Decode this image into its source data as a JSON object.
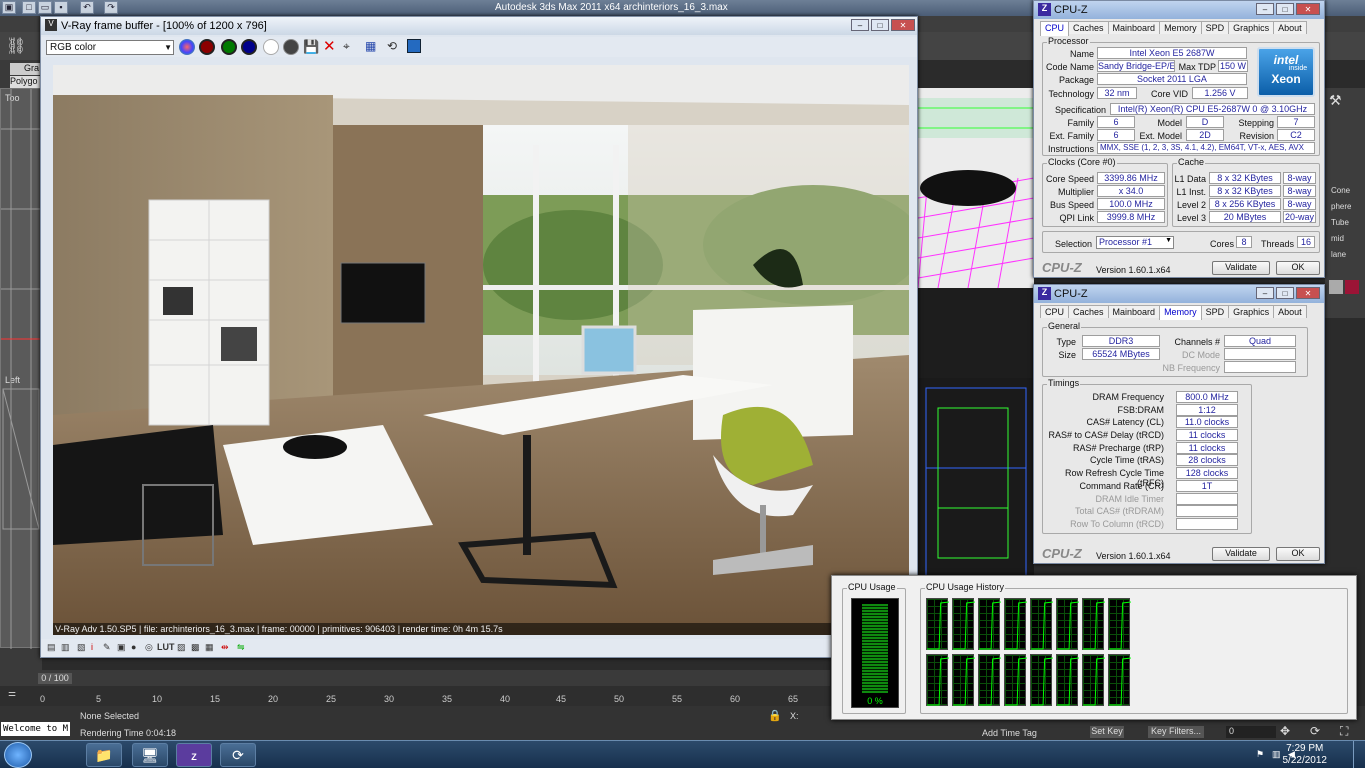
{
  "max": {
    "title": "Autodesk 3ds Max  2011 x64     archinteriors_16_3.max",
    "left_labels": [
      "Gra",
      "Polygo",
      "Too",
      "Left"
    ],
    "status": {
      "selection": "None Selected",
      "render_time": "Rendering Time  0:04:18",
      "frame_counter": "0 / 100",
      "coord": "X:"
    },
    "timeline_ticks": [
      "0",
      "5",
      "10",
      "15",
      "20",
      "25",
      "30",
      "35",
      "40",
      "45",
      "50",
      "55",
      "60",
      "65"
    ],
    "right_labels": [
      "Add Time Tag",
      "Set Key",
      "Key Filters...",
      "0"
    ],
    "cmd_labels": [
      "Cone",
      "phere",
      "Tube",
      "mid",
      "lane"
    ],
    "maxscript": "Welcome to M"
  },
  "vray": {
    "title": "V-Ray frame buffer - [100% of 1200 x 796]",
    "channel": "RGB color",
    "status_line": "V-Ray Adv 1.50.SP5 | file: archinteriors_16_3.max | frame: 00000 | primitives: 906403 | render time: 0h 4m 15.7s",
    "bottom_label": "LUT"
  },
  "cpuz1": {
    "title": "CPU-Z",
    "tabs": [
      "CPU",
      "Caches",
      "Mainboard",
      "Memory",
      "SPD",
      "Graphics",
      "About"
    ],
    "active_tab": "CPU",
    "processor_group": "Processor",
    "name_l": "Name",
    "name": "Intel Xeon E5 2687W",
    "codename_l": "Code Name",
    "codename": "Sandy Bridge-EP/EX",
    "maxtdp_l": "Max TDP",
    "maxtdp": "150 W",
    "package_l": "Package",
    "package": "Socket 2011 LGA",
    "technology_l": "Technology",
    "technology": "32 nm",
    "corevid_l": "Core VID",
    "corevid": "1.256 V",
    "spec_l": "Specification",
    "spec": "Intel(R) Xeon(R) CPU E5-2687W 0 @ 3.10GHz",
    "family_l": "Family",
    "family": "6",
    "model_l": "Model",
    "model": "D",
    "stepping_l": "Stepping",
    "stepping": "7",
    "extfamily_l": "Ext. Family",
    "extfamily": "6",
    "extmodel_l": "Ext. Model",
    "extmodel": "2D",
    "revision_l": "Revision",
    "revision": "C2",
    "instr_l": "Instructions",
    "instr": "MMX, SSE (1, 2, 3, 3S, 4.1, 4.2), EM64T, VT-x, AES, AVX",
    "clocks_group": "Clocks (Core #0)",
    "corespeed_l": "Core Speed",
    "corespeed": "3399.86 MHz",
    "mult_l": "Multiplier",
    "mult": "x 34.0",
    "bus_l": "Bus Speed",
    "bus": "100.0 MHz",
    "qpi_l": "QPI Link",
    "qpi": "3999.8 MHz",
    "cache_group": "Cache",
    "l1d_l": "L1 Data",
    "l1d": "8 x 32 KBytes",
    "l1d_w": "8-way",
    "l1i_l": "L1 Inst.",
    "l1i": "8 x 32 KBytes",
    "l1i_w": "8-way",
    "l2_l": "Level 2",
    "l2": "8 x 256 KBytes",
    "l2_w": "8-way",
    "l3_l": "Level 3",
    "l3": "20 MBytes",
    "l3_w": "20-way",
    "selection_l": "Selection",
    "selection": "Processor #1",
    "cores_l": "Cores",
    "cores": "8",
    "threads_l": "Threads",
    "threads": "16",
    "brand": "CPU-Z",
    "version": "Version 1.60.1.x64",
    "validate": "Validate",
    "ok": "OK",
    "logo_line1": "intel",
    "logo_line2": "inside",
    "logo_line3": "Xeon"
  },
  "cpuz2": {
    "title": "CPU-Z",
    "tabs": [
      "CPU",
      "Caches",
      "Mainboard",
      "Memory",
      "SPD",
      "Graphics",
      "About"
    ],
    "active_tab": "Memory",
    "general_group": "General",
    "type_l": "Type",
    "type": "DDR3",
    "size_l": "Size",
    "size": "65524 MBytes",
    "channels_l": "Channels #",
    "channels": "Quad",
    "dcmode_l": "DC Mode",
    "nbfreq_l": "NB Frequency",
    "timings_group": "Timings",
    "rows": [
      {
        "label": "DRAM Frequency",
        "value": "800.0 MHz"
      },
      {
        "label": "FSB:DRAM",
        "value": "1:12"
      },
      {
        "label": "CAS# Latency (CL)",
        "value": "11.0 clocks"
      },
      {
        "label": "RAS# to CAS# Delay (tRCD)",
        "value": "11 clocks"
      },
      {
        "label": "RAS# Precharge (tRP)",
        "value": "11 clocks"
      },
      {
        "label": "Cycle Time (tRAS)",
        "value": "28 clocks"
      },
      {
        "label": "Row Refresh Cycle Time (tRFC)",
        "value": "128 clocks"
      },
      {
        "label": "Command Rate (CR)",
        "value": "1T"
      },
      {
        "label": "DRAM Idle Timer",
        "value": ""
      },
      {
        "label": "Total CAS# (tRDRAM)",
        "value": ""
      },
      {
        "label": "Row To Column (tRCD)",
        "value": ""
      }
    ],
    "brand": "CPU-Z",
    "version": "Version 1.60.1.x64",
    "validate": "Validate",
    "ok": "OK"
  },
  "taskmgr": {
    "usage_label": "CPU Usage",
    "history_label": "CPU Usage History",
    "usage_value": "0 %",
    "usage_fraction": 0.97,
    "cores": 16
  },
  "taskbar": {
    "time": "7:29 PM",
    "date": "5/22/2012",
    "items": [
      "start-orb",
      "explorer",
      "monitor",
      "cpu-z",
      "3ds-max"
    ]
  },
  "colors": {
    "accent": "#0000cc",
    "graph": "#00ff00",
    "taskbar": "#1d3a5c"
  }
}
